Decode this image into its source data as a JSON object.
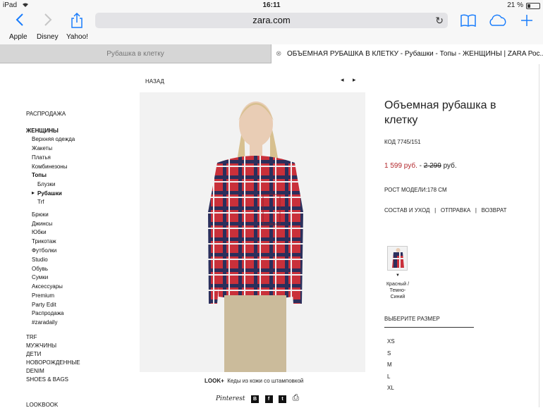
{
  "status": {
    "device": "iPad",
    "time": "16:11",
    "battery": "21 %"
  },
  "browser": {
    "url": "zara.com",
    "bookmarks": [
      "Apple",
      "Disney",
      "Yahoo!"
    ],
    "tabs": [
      {
        "title": "Рубашка в клетку"
      },
      {
        "title": "ОБЪЕМНАЯ РУБАШКА В КЛЕТКУ - Рубашки - Топы - ЖЕНЩИНЫ | ZARA Рос..."
      }
    ]
  },
  "nav": {
    "sale_top": "РАСПРОДАЖА",
    "women": "ЖЕНЩИНЫ",
    "women_items": [
      "Верхняя одежда",
      "Жакеты",
      "Платья",
      "Комбинезоны",
      "Топы"
    ],
    "tops_items": [
      "Блузки",
      "Рубашки",
      "Trf"
    ],
    "more_items": [
      "Брюки",
      "Джинсы",
      "Юбки",
      "Трикотаж",
      "Футболки",
      "Studio",
      "Обувь",
      "Сумки",
      "Аксессуары",
      "Premium",
      "Party Edit",
      "Распродажа",
      "#zaradaily"
    ],
    "sections": [
      "TRF",
      "МУЖЧИНЫ",
      "ДЕТИ",
      "НОВОРОЖДЕННЫЕ",
      "DENIM",
      "SHOES & BAGS"
    ],
    "lookbook": "LOOKBOOK"
  },
  "product": {
    "back": "НАЗАД",
    "prev": "◂",
    "next": "▸",
    "title": "Объемная рубашка в клетку",
    "code": "КОД 7745/151",
    "price_sale": "1 599 руб.",
    "price_sep": " - ",
    "price_old": "2 299",
    "price_currency": " руб.",
    "model_height": "РОСТ МОДЕЛИ:178 СМ",
    "links": [
      "СОСТАВ И УХОД",
      "ОТПРАВКА",
      "ВОЗВРАТ"
    ],
    "link_sep": "|",
    "color": "Красный / Темно-Синий",
    "size_label": "ВЫБЕРИТЕ РАЗМЕР",
    "sizes": [
      "XS",
      "S",
      "M",
      "L",
      "XL"
    ],
    "look_label": "LOOK+",
    "look_text": "Кеды из кожи со штамповкой",
    "share": {
      "pinterest": "Pinterest",
      "vk": "B",
      "fb": "f",
      "tw": "t",
      "print": "⎙"
    }
  }
}
